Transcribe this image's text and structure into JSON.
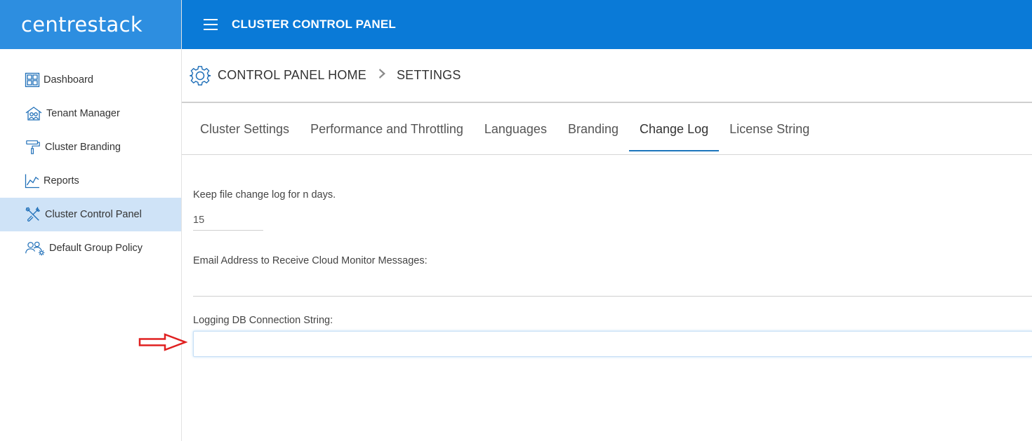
{
  "brand": {
    "logo_part1": "centre",
    "logo_part2": "stack"
  },
  "header": {
    "title": "CLUSTER CONTROL PANEL"
  },
  "sidebar": {
    "items": [
      {
        "label": "Dashboard",
        "icon": "dashboard-icon"
      },
      {
        "label": "Tenant Manager",
        "icon": "house-users-icon"
      },
      {
        "label": "Cluster Branding",
        "icon": "paint-roller-icon"
      },
      {
        "label": "Reports",
        "icon": "chart-line-icon"
      },
      {
        "label": "Cluster Control Panel",
        "icon": "tools-icon",
        "active": true
      },
      {
        "label": "Default Group Policy",
        "icon": "users-gear-icon"
      }
    ]
  },
  "breadcrumb": {
    "home": "CONTROL PANEL HOME",
    "current": "SETTINGS"
  },
  "tabs": [
    {
      "label": "Cluster Settings"
    },
    {
      "label": "Performance and Throttling"
    },
    {
      "label": "Languages"
    },
    {
      "label": "Branding"
    },
    {
      "label": "Change Log",
      "active": true
    },
    {
      "label": "License String"
    }
  ],
  "form": {
    "days_label": "Keep file change log for n days.",
    "days_value": "15",
    "email_label": "Email Address to Receive Cloud Monitor Messages:",
    "email_value": "",
    "db_label": "Logging DB Connection String:",
    "db_value": ""
  },
  "colors": {
    "header_bg": "#0a7ad7",
    "logo_bg": "#2d8ee0",
    "active_nav_bg": "#cfe3f7",
    "arrow": "#e02020",
    "icon_blue": "#1f6fb8"
  }
}
